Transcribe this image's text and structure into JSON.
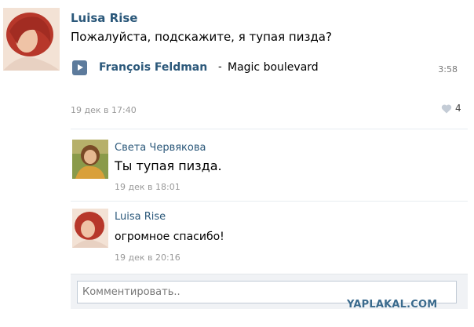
{
  "post": {
    "author": "Luisa Rise",
    "text": "Пожалуйста, подскажите, я тупая пизда?",
    "audio": {
      "artist": "François Feldman",
      "separator": "-",
      "title": "Magic boulevard",
      "duration": "3:58",
      "icon": "play-icon"
    },
    "date": "19 дек в 17:40",
    "likes": "4"
  },
  "comments": [
    {
      "author": "Света Червякова",
      "text": "Ты тупая пизда.",
      "date": "19 дек в 18:01"
    },
    {
      "author": "Luisa Rise",
      "text": "огромное спасибо!",
      "date": "19 дек в 20:16"
    }
  ],
  "reply": {
    "placeholder": "Комментировать.."
  },
  "watermark": "YAPLAKAL.COM",
  "colors": {
    "link": "#2b587a",
    "meta": "#999999",
    "play_button": "#5d7b9c"
  }
}
